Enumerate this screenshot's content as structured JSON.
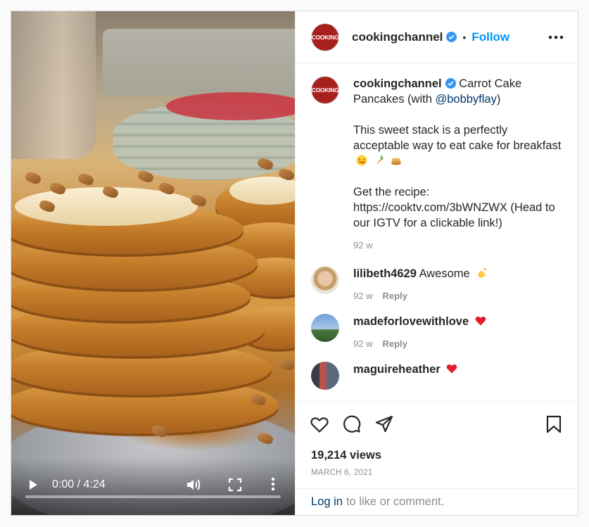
{
  "video": {
    "time_display": "0:00 / 4:24",
    "progress": 0
  },
  "header": {
    "avatar_text": "COOKING",
    "username": "cookingchannel",
    "separator": "•",
    "follow_label": "Follow"
  },
  "caption": {
    "avatar_text": "COOKING",
    "username": "cookingchannel",
    "title_before": "Carrot Cake Pancakes (with ",
    "mention": "@bobbyflay",
    "title_after": ")",
    "paragraph2": "This sweet stack is a perfectly acceptable way to eat cake for breakfast",
    "paragraph3": "Get the recipe: https://cooktv.com/3bWNZWX (Head to our IGTV for a clickable link!)",
    "age": "92 w"
  },
  "comments": [
    {
      "username": "lilibeth4629",
      "text": "Awesome",
      "age": "92 w",
      "reply_label": "Reply",
      "emoji": "clapping-hands"
    },
    {
      "username": "madeforlovewithlove",
      "text": "",
      "age": "92 w",
      "reply_label": "Reply",
      "emoji": "red-heart"
    },
    {
      "username": "maguireheather",
      "text": "",
      "emoji": "red-heart"
    }
  ],
  "stats": {
    "views": "19,214 views",
    "date": "MARCH 6, 2021"
  },
  "login": {
    "link_label": "Log in",
    "rest": "to like or comment."
  },
  "colors": {
    "accent": "#0095f6",
    "brand": "#a7201c",
    "verified": "#3897f0",
    "muted": "#8e8e8e",
    "heart": "#ed4956"
  }
}
